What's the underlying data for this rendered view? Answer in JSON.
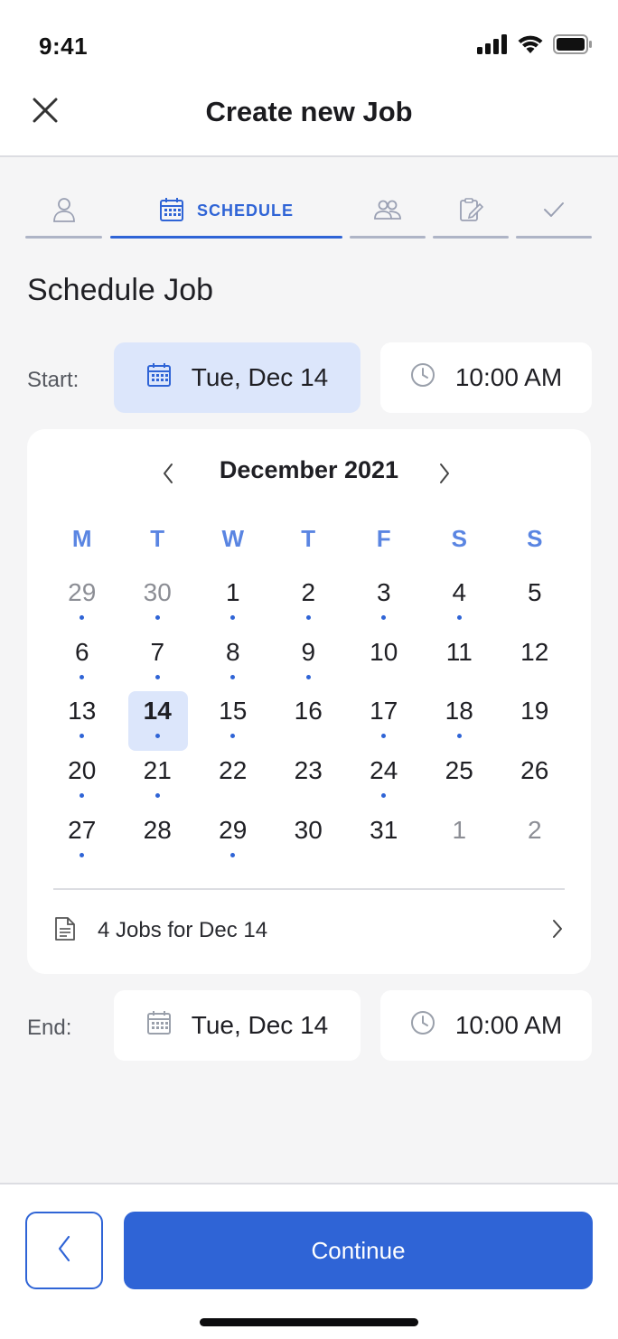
{
  "status_bar": {
    "time": "9:41"
  },
  "header": {
    "title": "Create new Job"
  },
  "stepper": {
    "steps": [
      {
        "icon": "person-icon",
        "label": ""
      },
      {
        "icon": "calendar-icon",
        "label": "SCHEDULE"
      },
      {
        "icon": "people-icon",
        "label": ""
      },
      {
        "icon": "clipboard-edit-icon",
        "label": ""
      },
      {
        "icon": "check-icon",
        "label": ""
      }
    ],
    "active_index": 1
  },
  "section_title": "Schedule Job",
  "start": {
    "label": "Start:",
    "date": "Tue, Dec 14",
    "time": "10:00 AM"
  },
  "calendar": {
    "month_label": "December 2021",
    "weekdays": [
      "M",
      "T",
      "W",
      "T",
      "F",
      "S",
      "S"
    ],
    "days": [
      {
        "n": "29",
        "muted": true,
        "dot": true
      },
      {
        "n": "30",
        "muted": true,
        "dot": true
      },
      {
        "n": "1",
        "dot": true
      },
      {
        "n": "2",
        "dot": true
      },
      {
        "n": "3",
        "dot": true
      },
      {
        "n": "4",
        "dot": true
      },
      {
        "n": "5"
      },
      {
        "n": "6",
        "dot": true
      },
      {
        "n": "7",
        "dot": true
      },
      {
        "n": "8",
        "dot": true
      },
      {
        "n": "9",
        "dot": true
      },
      {
        "n": "10"
      },
      {
        "n": "11"
      },
      {
        "n": "12"
      },
      {
        "n": "13",
        "dot": true
      },
      {
        "n": "14",
        "dot": true,
        "selected": true
      },
      {
        "n": "15",
        "dot": true
      },
      {
        "n": "16"
      },
      {
        "n": "17",
        "dot": true
      },
      {
        "n": "18",
        "dot": true
      },
      {
        "n": "19"
      },
      {
        "n": "20",
        "dot": true
      },
      {
        "n": "21",
        "dot": true
      },
      {
        "n": "22"
      },
      {
        "n": "23"
      },
      {
        "n": "24",
        "dot": true
      },
      {
        "n": "25"
      },
      {
        "n": "26"
      },
      {
        "n": "27",
        "dot": true
      },
      {
        "n": "28"
      },
      {
        "n": "29",
        "dot": true
      },
      {
        "n": "30"
      },
      {
        "n": "31"
      },
      {
        "n": "1",
        "muted": true
      },
      {
        "n": "2",
        "muted": true
      }
    ],
    "jobs_summary": "4 Jobs for Dec 14"
  },
  "end": {
    "label": "End:",
    "date": "Tue, Dec 14",
    "time": "10:00 AM"
  },
  "footer": {
    "continue_label": "Continue"
  },
  "colors": {
    "accent": "#2f64d6",
    "accent_light": "#dce6fb",
    "weekday": "#5a85e2",
    "inactive_step": "#aeb4c6"
  }
}
